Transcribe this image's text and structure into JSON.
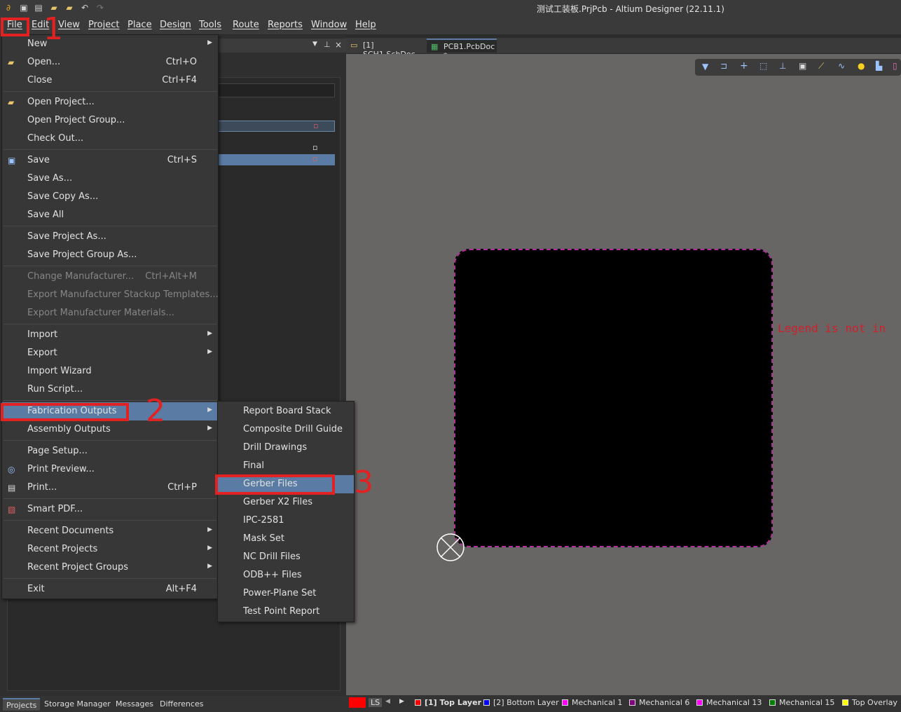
{
  "window": {
    "title": "测试工装板.PrjPcb - Altium Designer (22.11.1)"
  },
  "quick_access": [
    "logo-icon",
    "save-icon",
    "save-all-icon",
    "open-icon",
    "open-folder-icon",
    "undo-icon",
    "redo-icon"
  ],
  "menubar": [
    {
      "id": "file",
      "label": "File"
    },
    {
      "id": "edit",
      "label": "Edit"
    },
    {
      "id": "view",
      "label": "View"
    },
    {
      "id": "project",
      "label": "Project"
    },
    {
      "id": "place",
      "label": "Place"
    },
    {
      "id": "design",
      "label": "Design"
    },
    {
      "id": "tools",
      "label": "Tools"
    },
    {
      "id": "route",
      "label": "Route"
    },
    {
      "id": "reports",
      "label": "Reports"
    },
    {
      "id": "window",
      "label": "Window"
    },
    {
      "id": "help",
      "label": "Help"
    }
  ],
  "file_menu": {
    "items": [
      {
        "label": "New",
        "submenu": true
      },
      {
        "label": "Open...",
        "shortcut": "Ctrl+O",
        "icon": "open-folder-icon"
      },
      {
        "label": "Close",
        "shortcut": "Ctrl+F4"
      },
      {
        "label": "Open Project...",
        "icon": "open-project-icon"
      },
      {
        "label": "Open Project Group..."
      },
      {
        "label": "Check Out..."
      },
      {
        "label": "Save",
        "shortcut": "Ctrl+S",
        "icon": "save-icon"
      },
      {
        "label": "Save As..."
      },
      {
        "label": "Save Copy As..."
      },
      {
        "label": "Save All"
      },
      {
        "label": "Save Project As..."
      },
      {
        "label": "Save Project Group As..."
      },
      {
        "label": "Change Manufacturer...",
        "shortcut": "Ctrl+Alt+M",
        "disabled": true
      },
      {
        "label": "Export Manufacturer Stackup Templates...",
        "disabled": true
      },
      {
        "label": "Export Manufacturer Materials...",
        "disabled": true
      },
      {
        "label": "Import",
        "submenu": true
      },
      {
        "label": "Export",
        "submenu": true
      },
      {
        "label": "Import Wizard"
      },
      {
        "label": "Run Script..."
      },
      {
        "label": "Fabrication Outputs",
        "submenu": true,
        "highlighted": true
      },
      {
        "label": "Assembly Outputs",
        "submenu": true
      },
      {
        "label": "Page Setup..."
      },
      {
        "label": "Print Preview...",
        "icon": "print-preview-icon"
      },
      {
        "label": "Print...",
        "shortcut": "Ctrl+P",
        "icon": "print-icon"
      },
      {
        "label": "Smart PDF...",
        "icon": "smart-pdf-icon"
      },
      {
        "label": "Recent Documents",
        "submenu": true
      },
      {
        "label": "Recent Projects",
        "submenu": true
      },
      {
        "label": "Recent Project Groups",
        "submenu": true
      },
      {
        "label": "Exit",
        "shortcut": "Alt+F4"
      }
    ]
  },
  "fabrication_submenu": {
    "items": [
      {
        "label": "Report Board Stack"
      },
      {
        "label": "Composite Drill Guide"
      },
      {
        "label": "Drill Drawings"
      },
      {
        "label": "Final"
      },
      {
        "label": "Gerber Files",
        "highlighted": true
      },
      {
        "label": "Gerber X2 Files"
      },
      {
        "label": "IPC-2581"
      },
      {
        "label": "Mask Set"
      },
      {
        "label": "NC Drill Files"
      },
      {
        "label": "ODB++ Files"
      },
      {
        "label": "Power-Plane Set"
      },
      {
        "label": "Test Point Report"
      }
    ]
  },
  "annotations": {
    "step1": "1",
    "step2": "2",
    "step3": "3"
  },
  "doc_tabs": [
    {
      "label": "[1] SCH1.SchDoc",
      "icon": "schematic-icon",
      "active": false
    },
    {
      "label": "PCB1.PcbDoc *",
      "icon": "pcb-icon",
      "active": true
    }
  ],
  "canvas": {
    "legend_warning": "Legend is not in"
  },
  "panel_tabs": [
    "Projects",
    "Storage Manager",
    "Messages",
    "Differences"
  ],
  "layer_bar": {
    "current": "LS",
    "layers": [
      {
        "label": "[1] Top Layer",
        "color": "#ff0000",
        "active": true
      },
      {
        "label": "[2] Bottom Layer",
        "color": "#0000ff"
      },
      {
        "label": "Mechanical 1",
        "color": "#ff00ff"
      },
      {
        "label": "Mechanical 6",
        "color": "#800080"
      },
      {
        "label": "Mechanical 13",
        "color": "#ff00ff"
      },
      {
        "label": "Mechanical 15",
        "color": "#008000"
      },
      {
        "label": "Top Overlay",
        "color": "#ffff00"
      }
    ]
  },
  "colors": {
    "highlight": "#5a7ba3",
    "annotation_red": "#e22222",
    "canvas": "#686565",
    "board_outline": "#b0309a"
  }
}
